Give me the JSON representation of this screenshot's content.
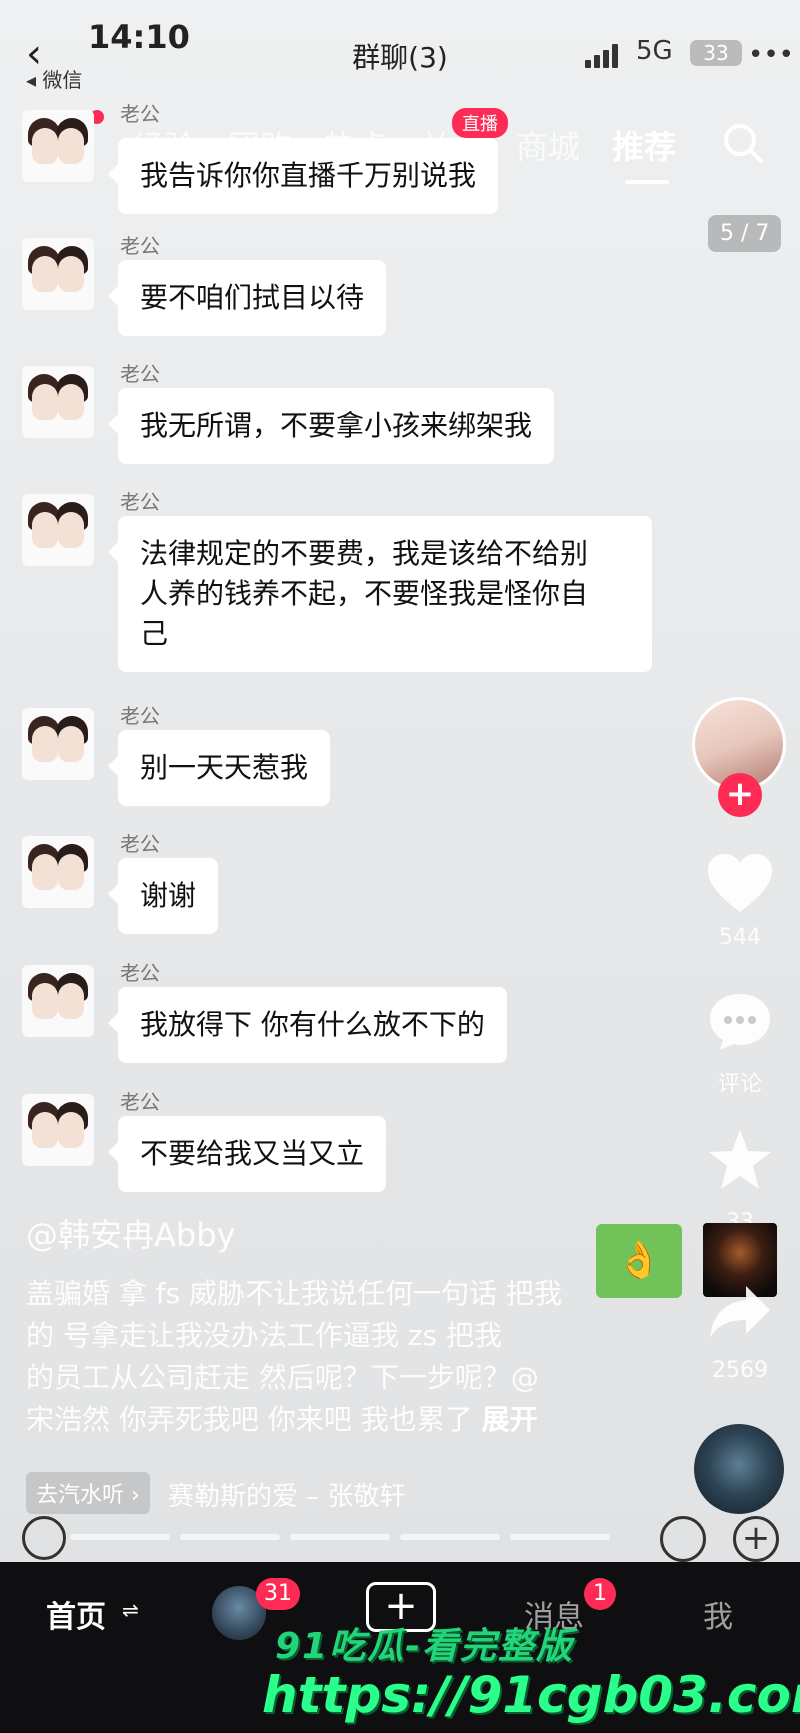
{
  "status_bar": {
    "time": "14:10",
    "back_label": "◂ 微信",
    "chat_title": "群聊(3)",
    "network": "5G",
    "battery": "33"
  },
  "top_nav": {
    "tabs": [
      "经验",
      "团购",
      "热点",
      "关注",
      "商城",
      "推荐"
    ],
    "active_tab": "推荐",
    "live_badge": "直播"
  },
  "page_counter": "5 / 7",
  "chat": {
    "messages": [
      {
        "sender": "老公",
        "text": "我告诉你你直播千万别说我"
      },
      {
        "sender": "老公",
        "text": "要不咱们拭目以待"
      },
      {
        "sender": "老公",
        "text": "我无所谓，不要拿小孩来绑架我"
      },
      {
        "sender": "老公",
        "text_lines": [
          "法律规定的不要费，我是该给不给别",
          "人养的钱养不起，不要怪我是怪你自",
          "己"
        ]
      },
      {
        "sender": "老公",
        "text": "别一天天惹我"
      },
      {
        "sender": "老公",
        "text": "谢谢"
      },
      {
        "sender": "老公",
        "text": "我放得下 你有什么放不下的"
      },
      {
        "sender": "老公",
        "text": "不要给我又当又立"
      }
    ]
  },
  "right_rail": {
    "likes": "544",
    "comments_label": "评论",
    "favorites": "33",
    "shares": "2569",
    "follow_symbol": "+"
  },
  "caption": {
    "author": "@韩安冉Abby",
    "lines": [
      "盖骗婚 拿 fs 威胁不让我说任何一句话 把我",
      "的  号拿走让我没办法工作逼我 zs  把我",
      "的员工从公司赶走 然后呢？下一步呢？@",
      "宋浩然 你弄死我吧 你来吧 我也累了"
    ],
    "expand": "展开"
  },
  "music": {
    "tag": "去汽水听 ›",
    "name": "赛勒斯的爱 – 张敬轩"
  },
  "bottom_nav": {
    "home": "首页",
    "friends_badge": "31",
    "create": "+",
    "messages": "消息",
    "messages_badge": "1",
    "me": "我"
  },
  "watermark": {
    "line1": "91吃瓜-看完整版",
    "line2": "https://91cgb03.com"
  },
  "colors": {
    "accent": "#fe2c55",
    "watermark": "#2bff8b",
    "bubble": "#ffffff"
  }
}
